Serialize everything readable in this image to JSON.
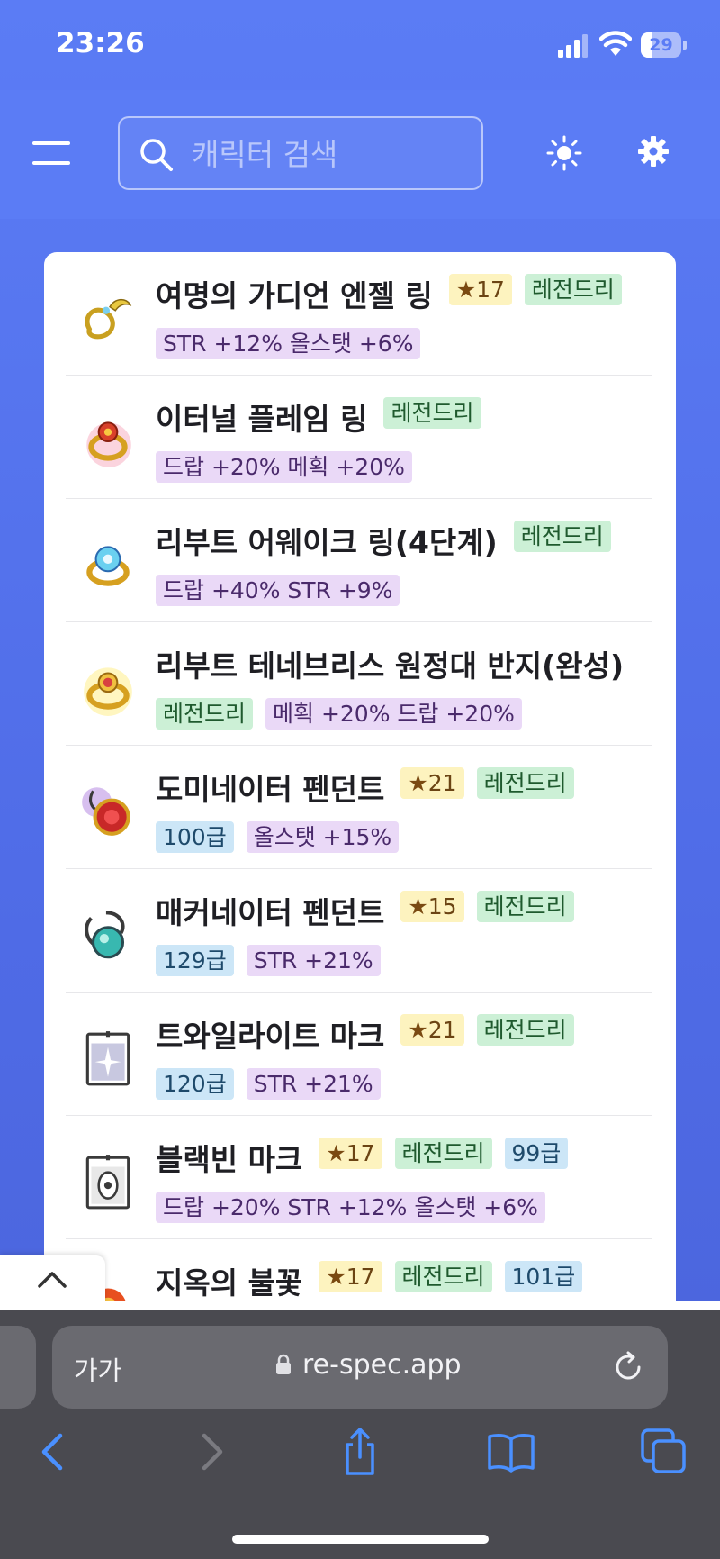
{
  "status_bar": {
    "time": "23:26",
    "battery": "29",
    "battery_level": 0.29
  },
  "header": {
    "search_placeholder": "캐릭터 검색"
  },
  "items": [
    {
      "name": "여명의 가디언 엔젤 링",
      "tags": [
        {
          "kind": "star",
          "text": "17"
        },
        {
          "kind": "legend",
          "text": "레전드리"
        },
        {
          "kind": "stat",
          "text": "STR +12% 올스탯 +6%"
        }
      ]
    },
    {
      "name": "이터널 플레임 링",
      "tags": [
        {
          "kind": "legend",
          "text": "레전드리"
        },
        {
          "kind": "stat",
          "text": "드랍 +20% 메획 +20%"
        }
      ]
    },
    {
      "name": "리부트 어웨이크 링(4단계)",
      "tags": [
        {
          "kind": "legend",
          "text": "레전드리"
        },
        {
          "kind": "stat",
          "text": "드랍 +40% STR +9%"
        }
      ]
    },
    {
      "name": "리부트 테네브리스 원정대 반지(완성)",
      "tags": [
        {
          "kind": "legend",
          "text": "레전드리"
        },
        {
          "kind": "stat",
          "text": "메획 +20% 드랍 +20%"
        }
      ]
    },
    {
      "name": "도미네이터 펜던트",
      "tags": [
        {
          "kind": "star",
          "text": "21"
        },
        {
          "kind": "legend",
          "text": "레전드리"
        },
        {
          "kind": "level",
          "text": "100급"
        },
        {
          "kind": "stat",
          "text": "올스탯 +15%"
        }
      ]
    },
    {
      "name": "매커네이터 펜던트",
      "tags": [
        {
          "kind": "star",
          "text": "15"
        },
        {
          "kind": "legend",
          "text": "레전드리"
        },
        {
          "kind": "level",
          "text": "129급"
        },
        {
          "kind": "stat",
          "text": "STR +21%"
        }
      ]
    },
    {
      "name": "트와일라이트 마크",
      "tags": [
        {
          "kind": "star",
          "text": "21"
        },
        {
          "kind": "legend",
          "text": "레전드리"
        },
        {
          "kind": "level",
          "text": "120급"
        },
        {
          "kind": "stat",
          "text": "STR +21%"
        }
      ]
    },
    {
      "name": "블랙빈 마크",
      "tags": [
        {
          "kind": "star",
          "text": "17"
        },
        {
          "kind": "legend",
          "text": "레전드리"
        },
        {
          "kind": "level",
          "text": "99급"
        },
        {
          "kind": "stat",
          "text": "드랍 +20% STR +12% 올스탯 +6%"
        }
      ]
    },
    {
      "name": "지옥의 불꽃",
      "tags": [
        {
          "kind": "star",
          "text": "17"
        },
        {
          "kind": "legend",
          "text": "레전드리"
        },
        {
          "kind": "level",
          "text": "101급"
        }
      ]
    }
  ],
  "browser": {
    "text_size_label": "가가",
    "url": "re-spec.app"
  },
  "icons": [
    "menu-icon",
    "search-icon",
    "sun-icon",
    "gear-icon",
    "chevron-up-icon",
    "lock-icon",
    "reload-icon",
    "back-icon",
    "forward-icon",
    "share-icon",
    "bookmarks-icon",
    "tabs-icon"
  ],
  "colors": {
    "accent": "#5b7cf5",
    "legend_tag": "#ccf0d6",
    "star_tag": "#fdf3bf",
    "level_tag": "#cce6f7",
    "stat_tag": "#ead9f7"
  }
}
